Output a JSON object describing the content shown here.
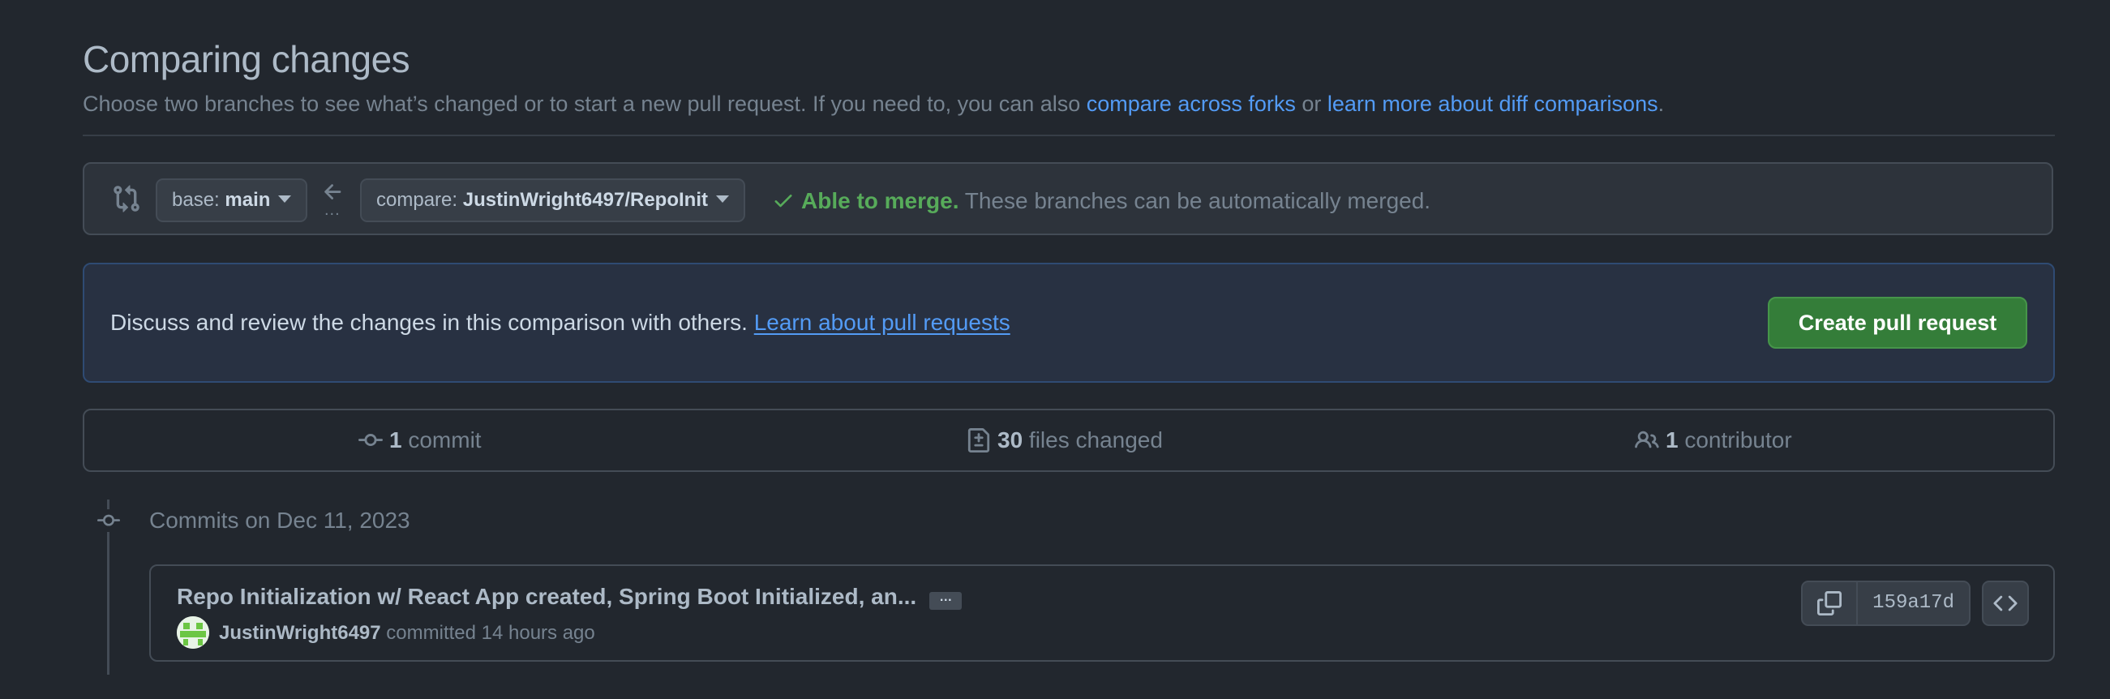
{
  "page": {
    "title": "Comparing changes",
    "subtitle_prefix": "Choose two branches to see what’s changed or to start a new pull request. If you need to, you can also ",
    "link_forks": "compare across forks",
    "subtitle_or": " or ",
    "link_learn_diff": "learn more about diff comparisons",
    "subtitle_suffix": "."
  },
  "range_editor": {
    "base_label": "base: ",
    "base_branch": "main",
    "compare_label": "compare: ",
    "compare_branch": "JustinWright6497/RepoInit",
    "dots": "...",
    "merge_status": "Able to merge.",
    "merge_message": " These branches can be automatically merged."
  },
  "discuss": {
    "text": "Discuss and review the changes in this comparison with others. ",
    "link": "Learn about pull requests",
    "button": "Create pull request"
  },
  "summary": {
    "commits_count": "1",
    "commits_label": " commit",
    "files_count": "30",
    "files_label": " files changed",
    "contributors_count": "1",
    "contributors_label": " contributor"
  },
  "commits": {
    "date_heading": "Commits on Dec 11, 2023",
    "items": [
      {
        "message": "Repo Initialization w/ React App created, Spring Boot Initialized, an...",
        "expand": "…",
        "author": "JustinWright6497",
        "action": " committed 14 hours ago",
        "sha": "159a17d"
      }
    ]
  },
  "colors": {
    "background": "#22272e",
    "link": "#539bf5",
    "success": "#57ab5a",
    "primary_button": "#347d39"
  },
  "icons": [
    "git-compare-icon",
    "arrow-left-icon",
    "caret-down-icon",
    "check-icon",
    "git-commit-icon",
    "file-diff-icon",
    "people-icon",
    "copy-icon",
    "code-icon",
    "avatar"
  ]
}
